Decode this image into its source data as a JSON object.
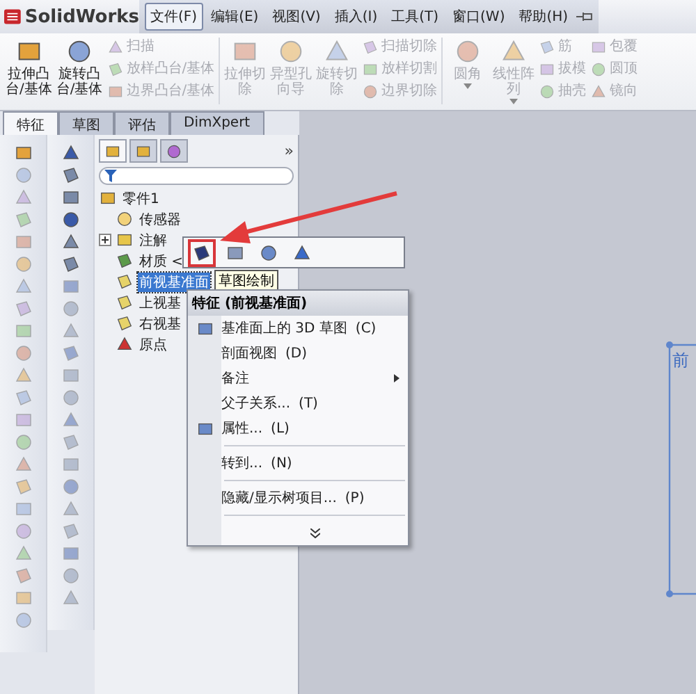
{
  "app": {
    "logo": "SolidWorks"
  },
  "menu": [
    {
      "label": "文件(F)",
      "selected": true
    },
    {
      "label": "编辑(E)",
      "selected": false
    },
    {
      "label": "视图(V)",
      "selected": false
    },
    {
      "label": "插入(I)",
      "selected": false
    },
    {
      "label": "工具(T)",
      "selected": false
    },
    {
      "label": "窗口(W)",
      "selected": false
    },
    {
      "label": "帮助(H)",
      "selected": false
    }
  ],
  "ribbon": [
    {
      "kind": "large",
      "lines": [
        "拉伸凸",
        "台/基体"
      ],
      "disabled": false,
      "menu": false
    },
    {
      "kind": "large",
      "lines": [
        "旋转凸",
        "台/基体"
      ],
      "disabled": false,
      "menu": false
    },
    {
      "kind": "stack",
      "items": [
        {
          "label": "扫描",
          "disabled": true
        },
        {
          "label": "放样凸台/基体",
          "disabled": true
        },
        {
          "label": "边界凸台/基体",
          "disabled": true
        }
      ]
    },
    {
      "kind": "separator"
    },
    {
      "kind": "large",
      "lines": [
        "拉伸切",
        "除"
      ],
      "disabled": true,
      "menu": false
    },
    {
      "kind": "large",
      "lines": [
        "异型孔",
        "向导"
      ],
      "disabled": true,
      "menu": false
    },
    {
      "kind": "large",
      "lines": [
        "旋转切",
        "除"
      ],
      "disabled": true,
      "menu": false
    },
    {
      "kind": "stack",
      "items": [
        {
          "label": "扫描切除",
          "disabled": true
        },
        {
          "label": "放样切割",
          "disabled": true
        },
        {
          "label": "边界切除",
          "disabled": true
        }
      ]
    },
    {
      "kind": "separator"
    },
    {
      "kind": "large",
      "lines": [
        "圆角"
      ],
      "disabled": true,
      "menu": true
    },
    {
      "kind": "large",
      "lines": [
        "线性阵",
        "列"
      ],
      "disabled": true,
      "menu": true
    },
    {
      "kind": "stack",
      "items": [
        {
          "label": "筋",
          "disabled": true
        },
        {
          "label": "拔模",
          "disabled": true
        },
        {
          "label": "抽壳",
          "disabled": true
        }
      ]
    },
    {
      "kind": "stack",
      "items": [
        {
          "label": "包覆",
          "disabled": true
        },
        {
          "label": "圆顶",
          "disabled": true
        },
        {
          "label": "镜向",
          "disabled": true
        }
      ]
    }
  ],
  "tabs": [
    {
      "label": "特征",
      "selected": true
    },
    {
      "label": "草图",
      "selected": false
    },
    {
      "label": "评估",
      "selected": false
    },
    {
      "label": "DimXpert",
      "selected": false
    }
  ],
  "panel": {
    "tabs": [
      {
        "selected": true
      },
      {
        "selected": false
      },
      {
        "selected": false
      }
    ],
    "more": "»"
  },
  "tree": {
    "label": "零件1",
    "kind": "part",
    "selected": false,
    "children": [
      {
        "label": "传感器",
        "kind": "sensor",
        "selected": false
      },
      {
        "label": "注解",
        "kind": "annotation",
        "selected": false,
        "expanded": false
      },
      {
        "label": "材质 <",
        "kind": "material",
        "selected": false
      },
      {
        "label": "前视基准面",
        "kind": "plane",
        "selected": true
      },
      {
        "label": "上视基",
        "kind": "plane",
        "selected": false
      },
      {
        "label": "右视基",
        "kind": "plane",
        "selected": false
      },
      {
        "label": "原点",
        "kind": "origin",
        "selected": false
      }
    ]
  },
  "context_toolbar": {
    "buttons": [
      {
        "highlighted": true
      },
      {
        "highlighted": false
      },
      {
        "highlighted": false
      },
      {
        "highlighted": false
      }
    ],
    "tooltip": "草图绘制"
  },
  "context_menu": {
    "title": "特征 (前视基准面)",
    "items": [
      {
        "kind": "item",
        "label": "基准面上的 3D 草图",
        "shortcut": "(C)",
        "icon": true,
        "submenu": false
      },
      {
        "kind": "item",
        "label": "剖面视图",
        "shortcut": "(D)",
        "icon": false,
        "submenu": false
      },
      {
        "kind": "item",
        "label": "备注",
        "icon": false,
        "submenu": true
      },
      {
        "kind": "item",
        "label": "父子关系...",
        "shortcut": "(T)",
        "icon": false,
        "submenu": false
      },
      {
        "kind": "item",
        "label": "属性...",
        "shortcut": "(L)",
        "icon": true,
        "submenu": false
      },
      {
        "kind": "separator"
      },
      {
        "kind": "item",
        "label": "转到...",
        "shortcut": "(N)",
        "icon": false,
        "submenu": false
      },
      {
        "kind": "separator"
      },
      {
        "kind": "item",
        "label": "隐藏/显示树项目...",
        "shortcut": "(P)",
        "icon": false,
        "submenu": false
      },
      {
        "kind": "separator"
      },
      {
        "kind": "more"
      }
    ]
  },
  "viewport": {
    "plane_label": "前"
  }
}
